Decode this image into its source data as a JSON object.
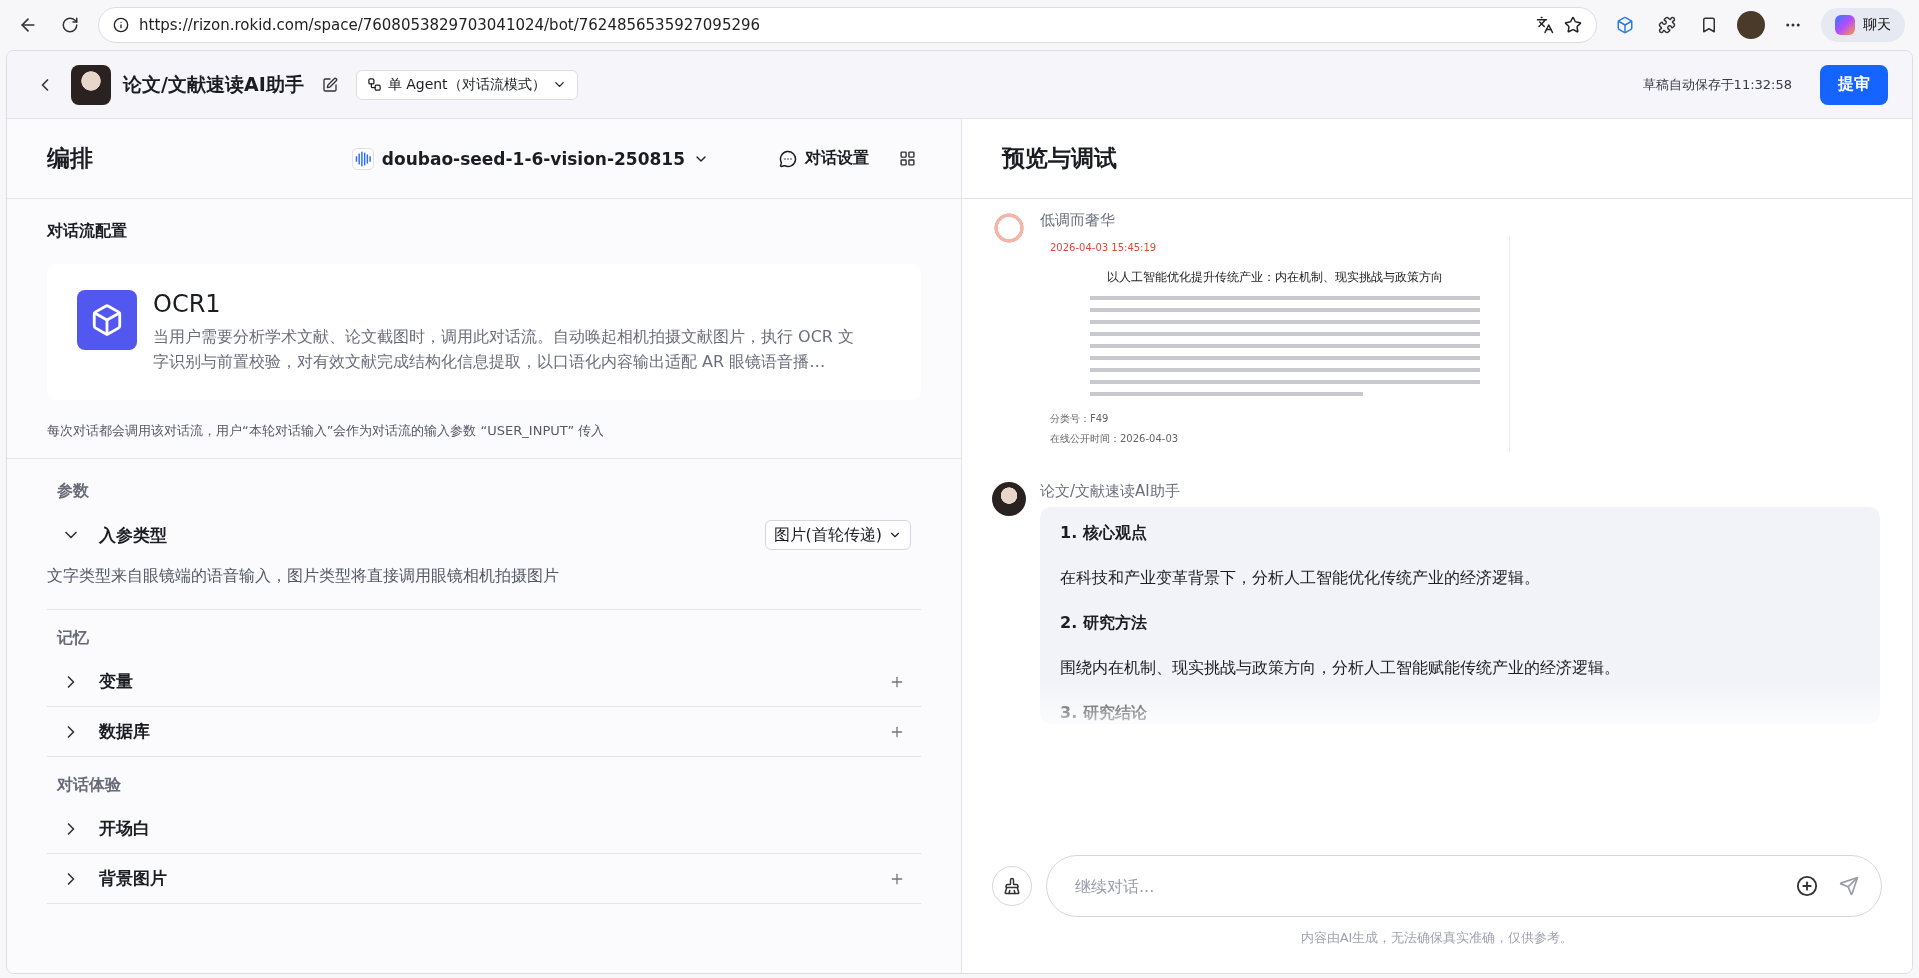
{
  "browser": {
    "url": "https://rizon.rokid.com/space/7608053829703041024/bot/7624856535927095296",
    "chat_button": "聊天"
  },
  "header": {
    "title": "论文/文献速读AI助手",
    "mode": "单 Agent（对话流模式）",
    "autosave": "草稿自动保存于11:32:58",
    "submit": "提审"
  },
  "left": {
    "title": "编排",
    "model": "doubao-seed-1-6-vision-250815",
    "settings": "对话设置",
    "flow_section": "对话流配置",
    "flow": {
      "name": "OCR1",
      "description": "当用户需要分析学术文献、论文截图时，调用此对话流。自动唤起相机拍摄文献图片，执行 OCR 文字识别与前置校验，对有效文献完成结构化信息提取，以口语化内容输出适配 AR 眼镜语音播…"
    },
    "flow_note": "每次对话都会调用该对话流，用户“本轮对话输入”会作为对话流的输入参数 “USER_INPUT” 传入",
    "groups": [
      {
        "title": "参数",
        "items": [
          {
            "label": "入参类型",
            "expanded": true,
            "select": "图片(首轮传递)",
            "description": "文字类型来自眼镜端的语音输入，图片类型将直接调用眼镜相机拍摄图片"
          }
        ]
      },
      {
        "title": "记忆",
        "items": [
          {
            "label": "变量",
            "expanded": false,
            "addable": true
          },
          {
            "label": "数据库",
            "expanded": false,
            "addable": true
          }
        ]
      },
      {
        "title": "对话体验",
        "items": [
          {
            "label": "开场白",
            "expanded": false,
            "addable": false
          },
          {
            "label": "背景图片",
            "expanded": false,
            "addable": true
          }
        ]
      }
    ]
  },
  "right": {
    "title": "预览与调试",
    "messages": [
      {
        "kind": "document",
        "sender": "低调而奢华",
        "document": {
          "timestamp": "2026-04-03 15:45:19",
          "title": "以人工智能优化提升传统产业：内在机制、现实挑战与政策方向",
          "fields": [
            {
              "label": "分类号：",
              "value": "F49"
            },
            {
              "label": "在线公开时间：",
              "value": "2026-04-03"
            }
          ]
        }
      },
      {
        "kind": "answer",
        "sender": "论文/文献速读AI助手",
        "blocks": [
          {
            "kind": "heading",
            "text": "1. 核心观点"
          },
          {
            "kind": "paragraph",
            "text": "在科技和产业变革背景下，分析人工智能优化传统产业的经济逻辑。"
          },
          {
            "kind": "heading",
            "text": "2. 研究方法"
          },
          {
            "kind": "paragraph",
            "text": "围绕内在机制、现实挑战与政策方向，分析人工智能赋能传统产业的经济逻辑。"
          },
          {
            "kind": "heading",
            "text": "3. 研究结论"
          }
        ]
      }
    ],
    "input": {
      "placeholder": "继续对话..."
    },
    "disclaimer": "内容由AI生成，无法确保真实准确，仅供参考。"
  }
}
